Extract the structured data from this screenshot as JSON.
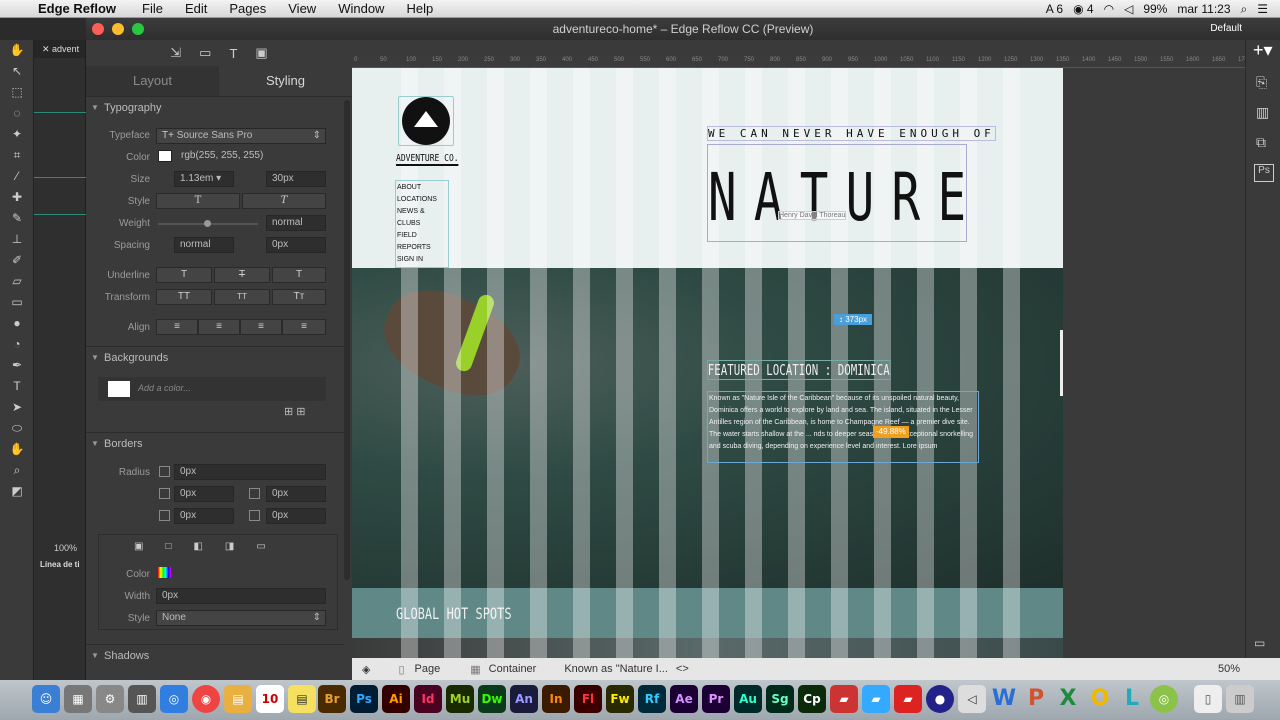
{
  "menubar": {
    "app_name": "Edge Reflow",
    "items": [
      "File",
      "Edit",
      "Pages",
      "View",
      "Window",
      "Help"
    ],
    "status_badge_6": "6",
    "status_badge_4": "4",
    "battery": "99%",
    "clock": "mar 11:23"
  },
  "window": {
    "title": "adventureco-home* – Edge Reflow CC (Preview)",
    "default_label": "Default"
  },
  "left_panel": {
    "tab_label": "advent",
    "zoom": "100%",
    "linea_label": "Línea de ti"
  },
  "styling": {
    "tabs": [
      "Layout",
      "Styling"
    ],
    "typography": {
      "section": "Typography",
      "typeface_label": "Typeface",
      "typeface_value": "Source Sans Pro",
      "color_label": "Color",
      "color_value": "rgb(255, 255, 255)",
      "size_label": "Size",
      "size_value": "1.13em",
      "line_height": "30px",
      "style_label": "Style",
      "weight_label": "Weight",
      "weight_value": "normal",
      "spacing_label": "Spacing",
      "spacing_value": "normal",
      "word_spacing": "0px",
      "underline_label": "Underline",
      "transform_label": "Transform",
      "align_label": "Align"
    },
    "backgrounds": {
      "section": "Backgrounds",
      "add_color": "Add a color..."
    },
    "borders": {
      "section": "Borders",
      "radius_label": "Radius",
      "radius_all": "0px",
      "r1": "0px",
      "r2": "0px",
      "r3": "0px",
      "r4": "0px",
      "color_label": "Color",
      "width_label": "Width",
      "width_value": "0px",
      "style_label": "Style",
      "style_value": "None"
    },
    "shadows": {
      "section": "Shadows"
    }
  },
  "design": {
    "brand": "ADVENTURE CO.",
    "nav": [
      "ABOUT",
      "LOCATIONS",
      "NEWS & CLUBS",
      "FIELD REPORTS",
      "SIGN IN"
    ],
    "tagline": "WE CAN NEVER HAVE ENOUGH OF",
    "hero_word": "NATURE",
    "attribution": "Henry David Thoreau",
    "featured_title": "FEATURED LOCATION : DOMINICA",
    "featured_body": "Known as \"Nature Isle of the Caribbean\" because of its unspoiled natural beauty, Dominica offers a world to explore by land and sea. The island, situated in the Lesser Antilles region of the Caribbean, is home to Champagne Reef — a premier dive site. The water starts shallow at the ... nds to deeper seas, offering exceptional snorkelling and scuba diving, depending on experience level and interest. Lore ipsum",
    "width_badge": "373px",
    "pct_badge": "-49.88%",
    "hot_spots": "GLOBAL HOT SPOTS"
  },
  "ruler_ticks": [
    "0",
    "50",
    "100",
    "150",
    "200",
    "250",
    "300",
    "350",
    "400",
    "450",
    "500",
    "550",
    "600",
    "650",
    "700",
    "750",
    "800",
    "850",
    "900",
    "950",
    "1000",
    "1050",
    "1100",
    "1150",
    "1200",
    "1250",
    "1300",
    "1350",
    "1400",
    "1450",
    "1500",
    "1550",
    "1600",
    "1650",
    "1700",
    "1750"
  ],
  "breadcrumb": {
    "page": "Page",
    "container": "Container",
    "element": "Known as \"Nature I...",
    "zoom": "50%"
  },
  "dock_apps": [
    "Br",
    "Ps",
    "Ai",
    "Id",
    "Mu",
    "Dw",
    "An",
    "In",
    "Fl",
    "Fw",
    "Rf",
    "Ae",
    "Pr",
    "Au",
    "Sg",
    "Cp"
  ],
  "colors": {
    "accent_blue": "#4a9fd8",
    "orange_badge": "#f0a020",
    "hot_bar": "#5f8886"
  }
}
